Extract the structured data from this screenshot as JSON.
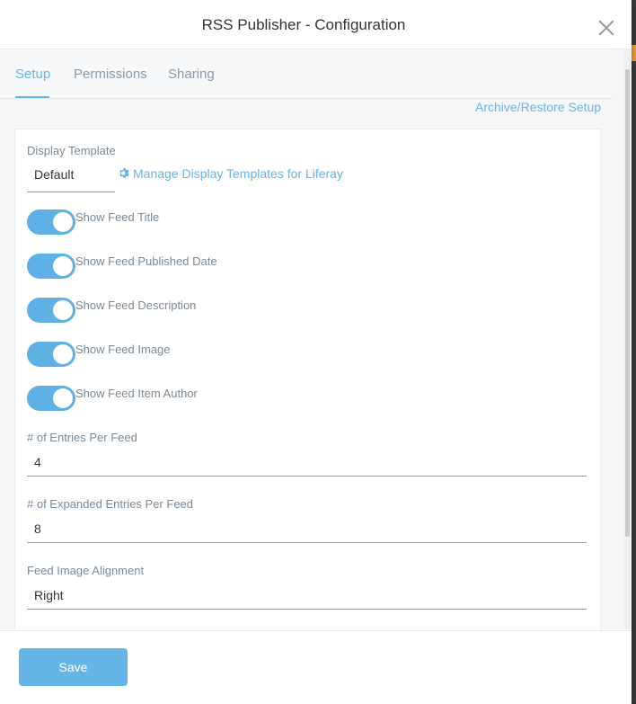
{
  "dialog": {
    "title": "RSS Publisher - Configuration"
  },
  "tabs": [
    {
      "label": "Setup",
      "active": true
    },
    {
      "label": "Permissions",
      "active": false
    },
    {
      "label": "Sharing",
      "active": false
    }
  ],
  "archive_restore_label": "Archive/Restore Setup",
  "display_template": {
    "label": "Display Template",
    "value": "Default",
    "manage_label": "Manage Display Templates for Liferay",
    "manage_icon": "gear-icon"
  },
  "toggles": [
    {
      "label": "Show Feed Title",
      "on": true
    },
    {
      "label": "Show Feed Published Date",
      "on": true
    },
    {
      "label": "Show Feed Description",
      "on": true
    },
    {
      "label": "Show Feed Image",
      "on": true
    },
    {
      "label": "Show Feed Item Author",
      "on": true
    }
  ],
  "fields": [
    {
      "label": "# of Entries Per Feed",
      "value": "4"
    },
    {
      "label": "# of Expanded Entries Per Feed",
      "value": "8"
    },
    {
      "label": "Feed Image Alignment",
      "value": "Right"
    }
  ],
  "footer": {
    "save_label": "Save"
  },
  "colors": {
    "accent": "#65b6e6",
    "toggle_on": "#5fb0e4",
    "label": "#7b8a96"
  }
}
